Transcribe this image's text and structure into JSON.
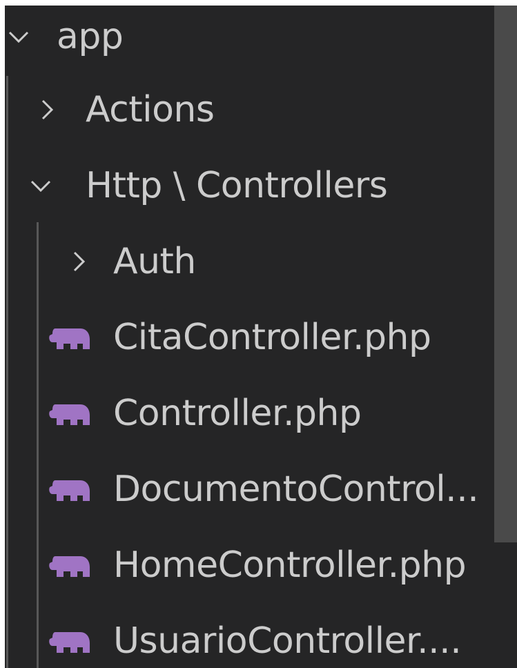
{
  "explorer": {
    "root": {
      "label": "app",
      "expanded": true,
      "icon": "chevron-down-icon"
    },
    "actions": {
      "label": "Actions",
      "expanded": false,
      "icon": "chevron-right-icon"
    },
    "http": {
      "label": "Http \\ Controllers",
      "expanded": true,
      "icon": "chevron-down-icon"
    },
    "auth": {
      "label": "Auth",
      "expanded": false,
      "icon": "chevron-right-icon"
    },
    "files": [
      {
        "label": "CitaController.php",
        "icon": "php-elephant-icon"
      },
      {
        "label": "Controller.php",
        "icon": "php-elephant-icon"
      },
      {
        "label": "DocumentoControl...",
        "icon": "php-elephant-icon"
      },
      {
        "label": "HomeController.php",
        "icon": "php-elephant-icon"
      },
      {
        "label": "UsuarioController....",
        "icon": "php-elephant-icon"
      }
    ]
  },
  "colors": {
    "background": "#252526",
    "text": "#cccccc",
    "php_icon": "#a074c4",
    "scrollbar": "#4a4a4a",
    "indent_guide": "#585858"
  }
}
